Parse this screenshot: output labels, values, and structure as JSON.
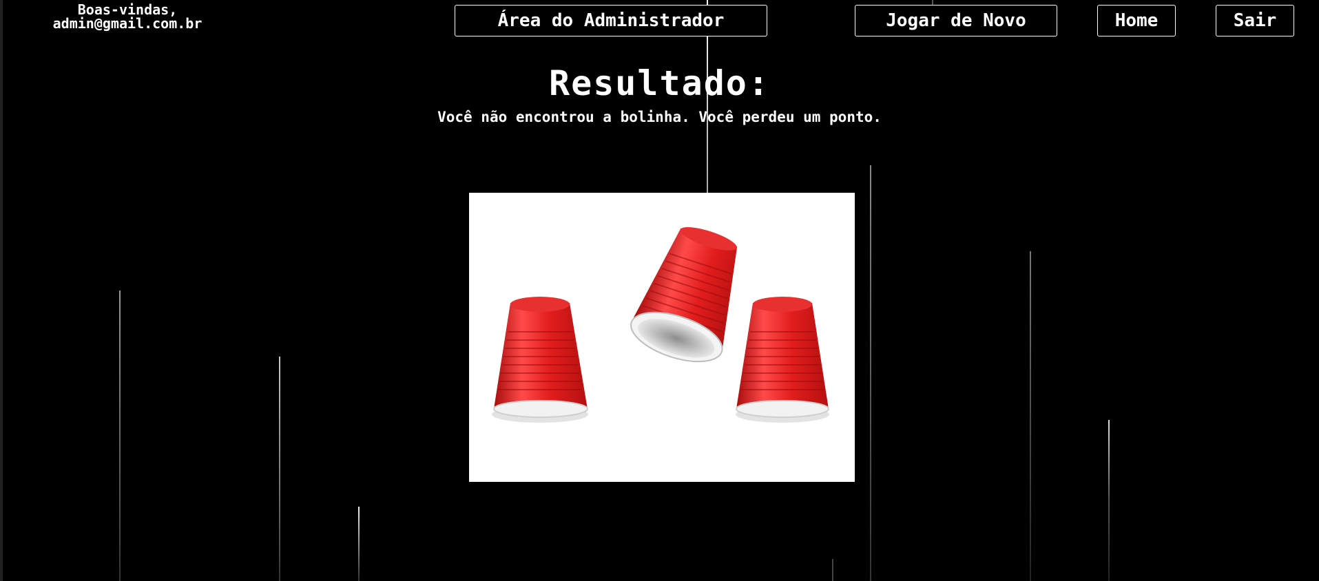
{
  "header": {
    "welcome_line1": "Boas-vindas,",
    "welcome_line2": "admin@gmail.com.br"
  },
  "nav": {
    "admin": "Área do Administrador",
    "play_again": "Jogar de Novo",
    "home": "Home",
    "logout": "Sair"
  },
  "result": {
    "title": "Resultado:",
    "message": "Você não encontrou a bolinha. Você perdeu um ponto."
  },
  "image": {
    "subject": "three red cups, one lifted and empty",
    "cup_color": "#e21d1d"
  }
}
